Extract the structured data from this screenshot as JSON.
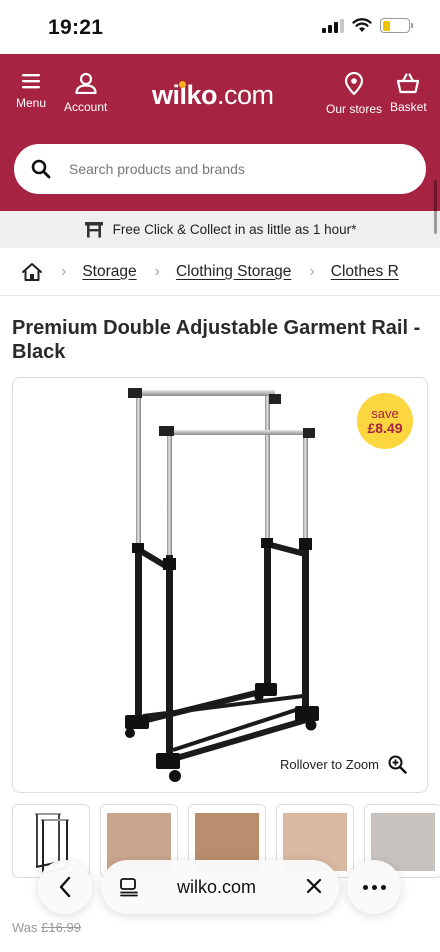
{
  "status_bar": {
    "time": "19:21"
  },
  "header": {
    "menu_label": "Menu",
    "account_label": "Account",
    "logo_text": "wilko",
    "logo_suffix": ".com",
    "stores_label": "Our stores",
    "basket_label": "Basket",
    "brand_color": "#a62342",
    "accent_color": "#f6b21b"
  },
  "search": {
    "placeholder": "Search products and brands",
    "value": ""
  },
  "promo": {
    "text": "Free Click & Collect in as little as 1 hour*"
  },
  "breadcrumb": {
    "items": [
      "Storage",
      "Clothing Storage",
      "Clothes R"
    ]
  },
  "product": {
    "title": "Premium Double Adjustable Garment Rail - Black",
    "save_word": "save",
    "save_amount": "£8.49",
    "zoom_hint": "Rollover to Zoom",
    "was_label": "Was",
    "was_price": "£16.99"
  },
  "browser": {
    "url": "wilko.com"
  },
  "icons": [
    "menu-icon",
    "account-icon",
    "store-pin-icon",
    "basket-icon",
    "search-icon",
    "collect-icon",
    "home-icon",
    "zoom-icon",
    "back-icon",
    "reader-icon",
    "close-icon",
    "more-icon"
  ]
}
